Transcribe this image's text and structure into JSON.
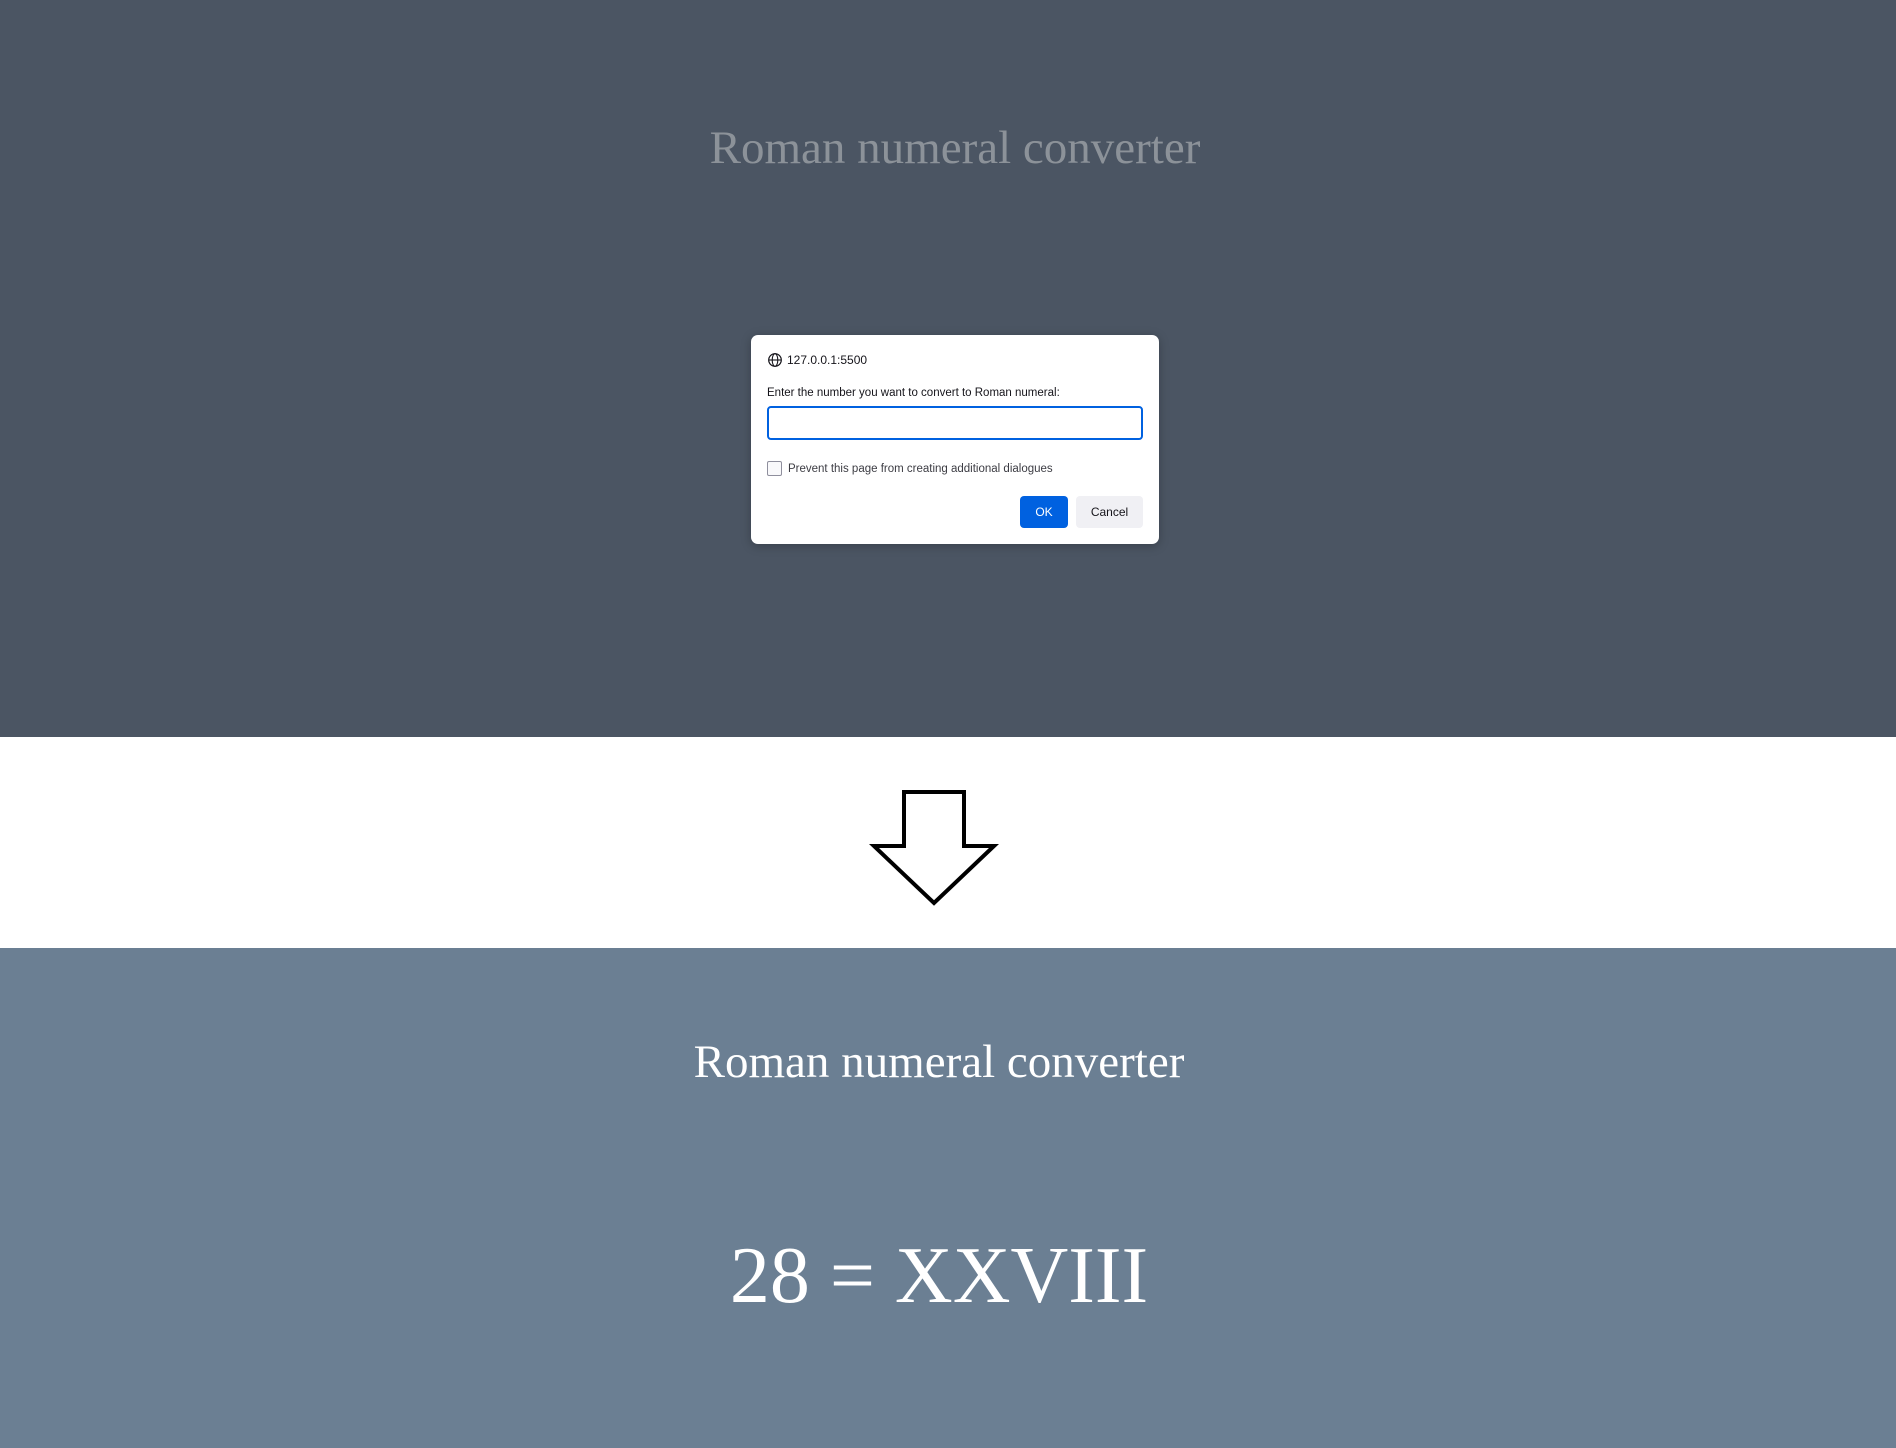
{
  "top": {
    "title": "Roman numeral converter",
    "background_color": "#4b5563",
    "dialog": {
      "origin": "127.0.0.1:5500",
      "origin_icon": "globe-icon",
      "message": "Enter the number you want to convert to Roman numeral:",
      "input_value": "",
      "checkbox_label": "Prevent this page from creating additional dialogues",
      "checkbox_checked": false,
      "ok_label": "OK",
      "cancel_label": "Cancel",
      "accent_color": "#0061e0"
    }
  },
  "transition": {
    "icon": "down-arrow-icon"
  },
  "bottom": {
    "title": "Roman numeral converter",
    "background_color": "#6b7f93",
    "result": "28 = XXVIII"
  }
}
